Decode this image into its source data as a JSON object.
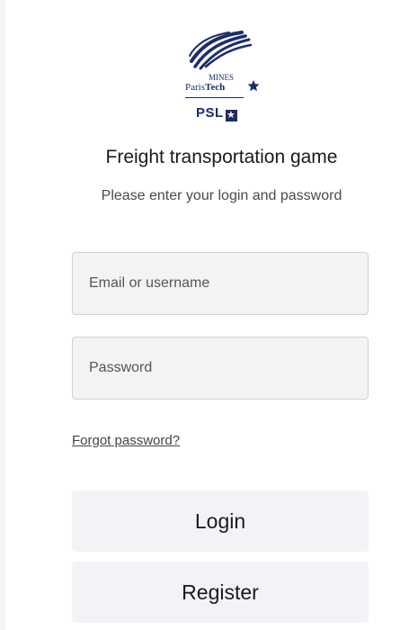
{
  "logo": {
    "mines": "MINES",
    "paris": "Paris",
    "tech": "Tech",
    "psl": "PSL",
    "star": "★"
  },
  "header": {
    "title": "Freight transportation game",
    "subtitle": "Please enter your login and password"
  },
  "form": {
    "email_placeholder": "Email or username",
    "password_placeholder": "Password",
    "forgot_label": "Forgot password?",
    "login_label": "Login",
    "register_label": "Register"
  },
  "colors": {
    "brand_navy": "#1c2d6b",
    "input_bg": "#f3f3f3",
    "button_bg": "#f3f3f7"
  },
  "icons": {
    "logo_mark": "swoosh-logo-icon",
    "star": "star-icon"
  }
}
